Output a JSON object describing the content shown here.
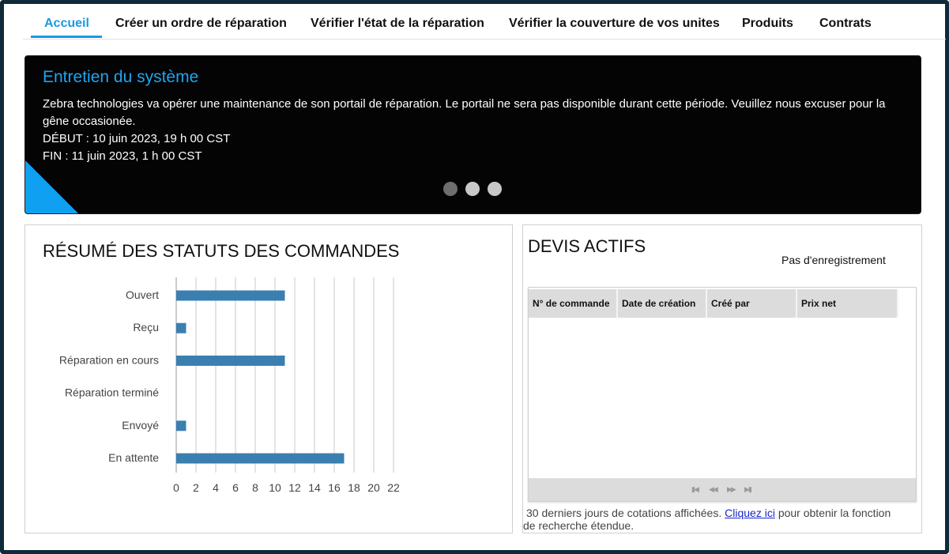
{
  "nav": {
    "items": [
      {
        "label": "Accueil",
        "active": true
      },
      {
        "label": "Créer un ordre de réparation",
        "active": false
      },
      {
        "label": "Vérifier l'état de la réparation",
        "active": false
      },
      {
        "label": "Vérifier la couverture de vos unites",
        "active": false
      },
      {
        "label": "Produits",
        "active": false
      },
      {
        "label": "Contrats",
        "active": false
      }
    ]
  },
  "banner": {
    "title": "Entretien du système",
    "message": "Zebra technologies va opérer une maintenance de son portail de réparation. Le portail ne sera pas disponible durant cette période. Veuillez nous excuser pour la gêne occasionée.",
    "start": "DÉBUT : 10 juin 2023, 19 h 00 CST",
    "end": "FIN : 11 juin 2023, 1 h 00 CST",
    "slides": 3,
    "active_slide": 0,
    "colors": {
      "title": "#1fa3f0",
      "corner": "#0fa0f2",
      "background": "#040404"
    }
  },
  "order_status": {
    "title": "RÉSUMÉ DES STATUTS DES COMMANDES"
  },
  "chart_data": {
    "type": "bar",
    "orientation": "horizontal",
    "categories": [
      "Ouvert",
      "Reçu",
      "Réparation en cours",
      "Réparation terminé",
      "Envoyé",
      "En attente"
    ],
    "values": [
      11,
      1,
      11,
      0,
      1,
      17
    ],
    "xticks": [
      0,
      2,
      4,
      6,
      8,
      10,
      12,
      14,
      16,
      18,
      20,
      22
    ],
    "xlim": [
      0,
      22
    ],
    "grid": true,
    "bar_color": "#3a7fb0"
  },
  "quotes": {
    "title": "DEVIS ACTIFS",
    "no_record": "Pas d'enregistrement",
    "columns": [
      "N° de commande",
      "Date de création",
      "Créé par",
      "Prix net"
    ],
    "rows": [],
    "pager": {
      "first": "first-page-icon",
      "prev": "prev-page-icon",
      "next": "next-page-icon",
      "last": "last-page-icon"
    },
    "footnote_before": "30 derniers jours de cotations affichées.",
    "footnote_link": "Cliquez ici",
    "footnote_after": "pour obtenir la fonction",
    "footnote_line2": "de recherche étendue."
  }
}
